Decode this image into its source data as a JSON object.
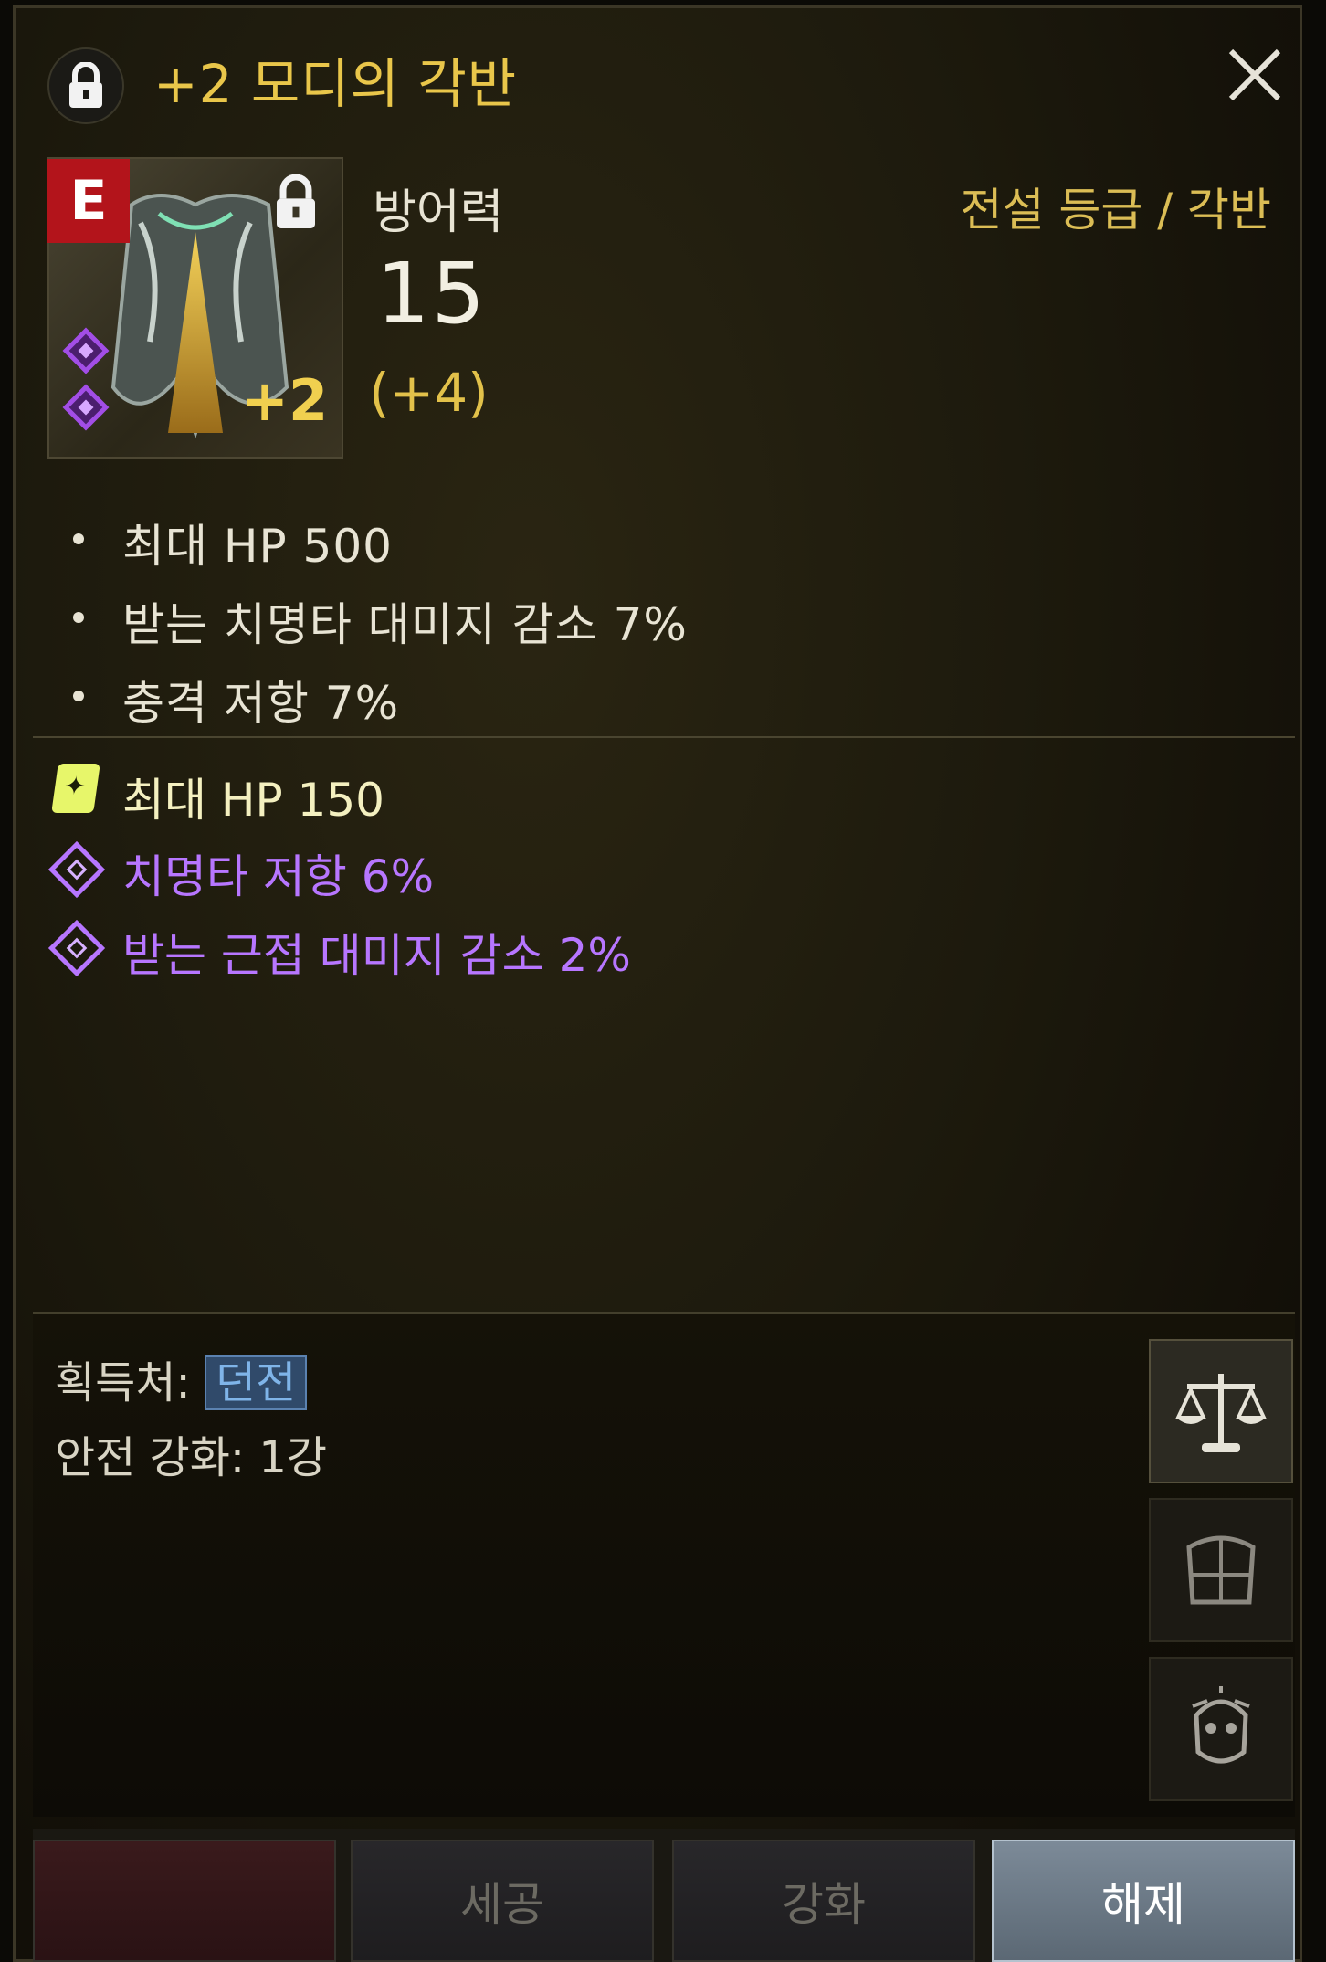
{
  "header": {
    "title": "+2 모디의 각반",
    "lock_icon": "lock-icon",
    "close_icon": "close-icon"
  },
  "item": {
    "grade_badge": "E",
    "enhance_label": "+2",
    "grade_text": "전설 등급 / 각반",
    "defense_label": "방어력",
    "defense_value": "15",
    "defense_bonus": "(+4)"
  },
  "base_stats": [
    "최대 HP  500",
    "받는 치명타 대미지 감소  7%",
    "충격 저항  7%"
  ],
  "sub_stats": {
    "scroll": "최대 HP  150",
    "gems": [
      "치명타 저항  6%",
      "받는 근접 대미지 감소  2%"
    ]
  },
  "info": {
    "source_label": "획득처: ",
    "source_value": "던전",
    "safe_enhance": "안전 강화: 1강"
  },
  "side_buttons": [
    "scale-icon",
    "armor-icon",
    "helmet-icon"
  ],
  "buttons": {
    "btn1": "",
    "btn2": "세공",
    "btn3": "강화",
    "btn4": "해제"
  },
  "colors": {
    "title": "#e9c64a",
    "gem_purple": "#b776ff",
    "scroll_yellow": "#f4f0c0",
    "badge_red": "#b3141b"
  }
}
